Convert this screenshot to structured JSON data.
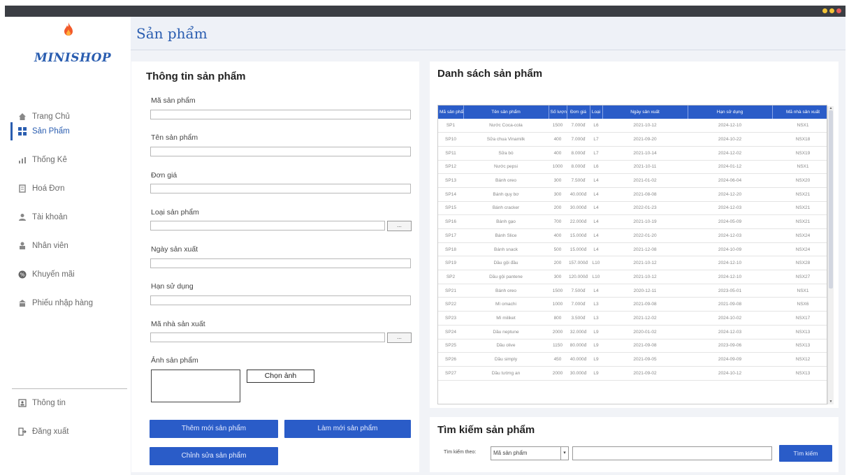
{
  "window": {
    "dot_colors": [
      "#f0c030",
      "#f0c030",
      "#e05050"
    ]
  },
  "sidebar": {
    "logo_text": "MINISHOP",
    "items": [
      {
        "label": "Trang Chủ",
        "icon": "home-icon"
      },
      {
        "label": "Sản Phẩm",
        "icon": "grid-icon",
        "active": true
      },
      {
        "label": "Thống Kê",
        "icon": "chart-icon"
      },
      {
        "label": "Hoá Đơn",
        "icon": "bill-icon"
      },
      {
        "label": "Tài khoản",
        "icon": "user-icon"
      },
      {
        "label": "Nhân viên",
        "icon": "staff-icon"
      },
      {
        "label": "Khuyến mãi",
        "icon": "promo-icon"
      },
      {
        "label": "Phiếu nhập hàng",
        "icon": "import-icon"
      }
    ],
    "bottom": [
      {
        "label": "Thông tin",
        "icon": "info-icon"
      },
      {
        "label": "Đăng xuất",
        "icon": "logout-icon"
      }
    ]
  },
  "header": {
    "title": "Sản phẩm"
  },
  "form": {
    "title": "Thông tin sản phẩm",
    "fields": {
      "product_id": {
        "label": "Mã sản phẩm",
        "value": ""
      },
      "product_name": {
        "label": "Tên sản phẩm",
        "value": ""
      },
      "price": {
        "label": "Đơn giá",
        "value": ""
      },
      "category": {
        "label": "Loại sản phẩm",
        "value": "",
        "browse": "..."
      },
      "mfg_date": {
        "label": "Ngày sản xuất",
        "value": ""
      },
      "expiry": {
        "label": "Hạn sử dụng",
        "value": ""
      },
      "manufacturer": {
        "label": "Mã nhà sản xuất",
        "value": "",
        "browse": "..."
      },
      "image": {
        "label": "Ảnh sản phẩm"
      }
    },
    "choose_image": "Chọn ảnh",
    "buttons": {
      "add": "Thêm mới sản phẩm",
      "refresh": "Làm mới sản phẩm",
      "edit": "Chỉnh sửa sản phẩm"
    }
  },
  "list": {
    "title": "Danh sách sản phẩm",
    "columns": [
      "Mã sản phẩm",
      "Tên sản phẩm",
      "Số lượng",
      "Đơn giá",
      "Loại",
      "Ngày sản xuất",
      "Hạn sử dụng",
      "Mã nhà sản xuất"
    ],
    "rows": [
      [
        "SP1",
        "Nước Coca-cola",
        "1500",
        "7.000đ",
        "L6",
        "2021-10-12",
        "2024-12-10",
        "NSX1"
      ],
      [
        "SP10",
        "Sữa chua Vinamilk",
        "400",
        "7.000đ",
        "L7",
        "2021-09-20",
        "2024-10-22",
        "NSX18"
      ],
      [
        "SP11",
        "Sữa bò",
        "400",
        "8.000đ",
        "L7",
        "2021-10-14",
        "2024-12-02",
        "NSX19"
      ],
      [
        "SP12",
        "Nước pepsi",
        "1000",
        "8.000đ",
        "L6",
        "2021-10-11",
        "2024-01-12",
        "NSX1"
      ],
      [
        "SP13",
        "Bánh oreo",
        "300",
        "7.500đ",
        "L4",
        "2021-01-02",
        "2024-06-04",
        "NSX20"
      ],
      [
        "SP14",
        "Bánh quy bơ",
        "300",
        "40.000đ",
        "L4",
        "2021-08-08",
        "2024-12-20",
        "NSX21"
      ],
      [
        "SP15",
        "Bánh cracker",
        "200",
        "30.000đ",
        "L4",
        "2022-01-23",
        "2024-12-03",
        "NSX21"
      ],
      [
        "SP16",
        "Bánh gạo",
        "700",
        "22.000đ",
        "L4",
        "2021-10-19",
        "2024-05-09",
        "NSX21"
      ],
      [
        "SP17",
        "Bánh Slice",
        "400",
        "15.000đ",
        "L4",
        "2022-01-20",
        "2024-12-03",
        "NSX24"
      ],
      [
        "SP18",
        "Bánh snack",
        "500",
        "15.000đ",
        "L4",
        "2021-12-08",
        "2024-10-09",
        "NSX24"
      ],
      [
        "SP19",
        "Dầu gội đầu",
        "200",
        "157.000đ",
        "L10",
        "2021-10-12",
        "2024-12-10",
        "NSX28"
      ],
      [
        "SP2",
        "Dầu gội pantene",
        "300",
        "120.000đ",
        "L10",
        "2021-10-12",
        "2024-12-10",
        "NSX27"
      ],
      [
        "SP21",
        "Bánh oreo",
        "1500",
        "7.500đ",
        "L4",
        "2020-12-11",
        "2023-05-01",
        "NSX1"
      ],
      [
        "SP22",
        "Mì omachi",
        "1000",
        "7.000đ",
        "L3",
        "2021-09-08",
        "2021-09-08",
        "NSX6"
      ],
      [
        "SP23",
        "Mì miliket",
        "800",
        "3.500đ",
        "L3",
        "2021-12-02",
        "2024-10-02",
        "NSX17"
      ],
      [
        "SP24",
        "Dầu neptune",
        "2000",
        "32.000đ",
        "L9",
        "2020-01-02",
        "2024-12-03",
        "NSX13"
      ],
      [
        "SP25",
        "Dầu olive",
        "1150",
        "80.000đ",
        "L9",
        "2021-09-08",
        "2023-09-06",
        "NSX13"
      ],
      [
        "SP26",
        "Dầu simply",
        "450",
        "40.000đ",
        "L9",
        "2021-09-05",
        "2024-09-09",
        "NSX12"
      ],
      [
        "SP27",
        "Dầu tường an",
        "2000",
        "30.000đ",
        "L9",
        "2021-09-02",
        "2024-10-12",
        "NSX13"
      ]
    ]
  },
  "search": {
    "title": "Tìm kiếm sản phẩm",
    "label": "Tìm kiếm theo:",
    "selected": "Mã sản phẩm",
    "query": "",
    "button": "Tìm kiếm"
  }
}
